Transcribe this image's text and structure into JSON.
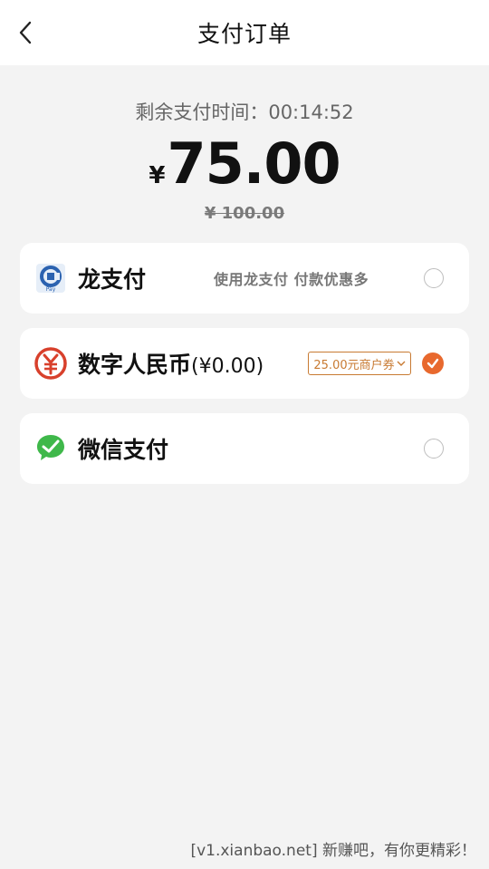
{
  "header": {
    "title": "支付订单"
  },
  "order": {
    "timer_text": "剩余支付时间：00:14:52",
    "currency_symbol": "¥",
    "amount": "75.00",
    "original_price": "¥ 100.00"
  },
  "payment_methods": [
    {
      "label": "龙支付",
      "promo": "使用龙支付 付款优惠多",
      "selected": false,
      "icon": "long-pay-icon"
    },
    {
      "label": "数字人民币",
      "balance": "(¥0.00)",
      "coupon": "25.00元商户券",
      "selected": true,
      "icon": "digital-rmb-icon"
    },
    {
      "label": "微信支付",
      "selected": false,
      "icon": "wechat-pay-icon"
    }
  ],
  "footer": {
    "watermark": "[v1.xianbao.net] 新赚吧，有你更精彩！"
  },
  "colors": {
    "accent": "#e8692e",
    "coupon": "#c87a32",
    "rmb_red": "#d8402c",
    "wechat_green": "#3fb84a"
  }
}
